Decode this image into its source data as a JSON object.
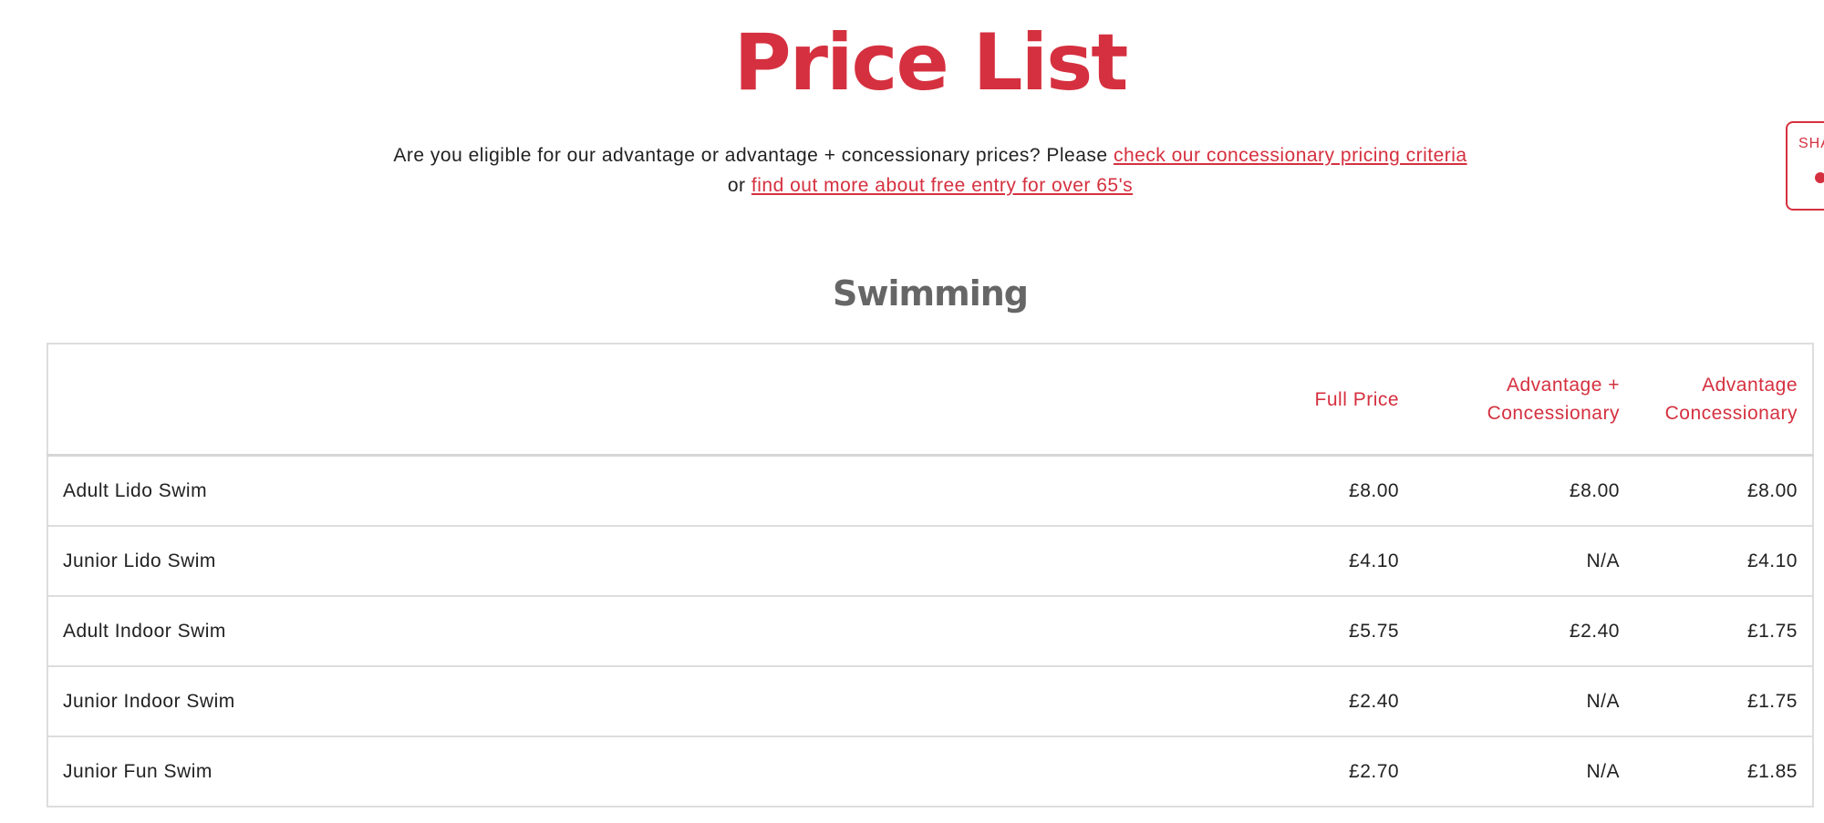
{
  "page": {
    "title": "Price List",
    "intro": {
      "text_before": "Are you eligible for our advantage or advantage + concessionary prices? Please ",
      "link1_text": "check our concessionary pricing criteria",
      "between": " or ",
      "link2_text": "find out more about free entry for over 65's"
    },
    "share_tab": {
      "label": "SHA"
    }
  },
  "section": {
    "title": "Swimming"
  },
  "table": {
    "headers": [
      "",
      "Full Price",
      "Advantage + Concessionary",
      "Advantage Concessionary"
    ],
    "rows": [
      {
        "name": "Adult Lido Swim",
        "full_price": "£8.00",
        "advantage_plus_concessionary": "£8.00",
        "advantage_concessionary": "£8.00"
      },
      {
        "name": "Junior Lido Swim",
        "full_price": "£4.10",
        "advantage_plus_concessionary": "N/A",
        "advantage_concessionary": "£4.10"
      },
      {
        "name": "Adult Indoor Swim",
        "full_price": "£5.75",
        "advantage_plus_concessionary": "£2.40",
        "advantage_concessionary": "£1.75"
      },
      {
        "name": "Junior Indoor Swim",
        "full_price": "£2.40",
        "advantage_plus_concessionary": "N/A",
        "advantage_concessionary": "£1.75"
      },
      {
        "name": "Junior Fun Swim",
        "full_price": "£2.70",
        "advantage_plus_concessionary": "N/A",
        "advantage_concessionary": "£1.85"
      }
    ]
  },
  "colors": {
    "accent": "#d5303f",
    "section_title": "#666666",
    "text": "#222222",
    "border": "#dddddd"
  },
  "icons": {
    "share": "share-icon"
  }
}
